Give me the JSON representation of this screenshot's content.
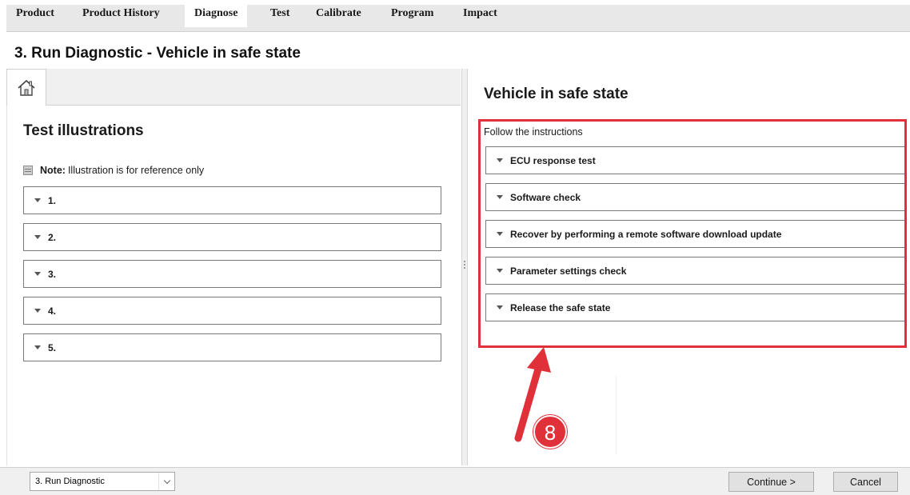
{
  "menu": {
    "items": [
      {
        "label": "Product"
      },
      {
        "label": "Product History"
      },
      {
        "label": "Diagnose",
        "active": true
      },
      {
        "label": "Test"
      },
      {
        "label": "Calibrate"
      },
      {
        "label": "Program"
      },
      {
        "label": "Impact"
      }
    ]
  },
  "page": {
    "title": "3. Run Diagnostic - Vehicle in safe state"
  },
  "left": {
    "home_icon": "home-icon",
    "heading": "Test illustrations",
    "note_label": "Note:",
    "note_text": "Illustration is for reference only",
    "items": [
      {
        "label": "1."
      },
      {
        "label": "2."
      },
      {
        "label": "3."
      },
      {
        "label": "4."
      },
      {
        "label": "5."
      }
    ]
  },
  "right": {
    "heading": "Vehicle in safe state",
    "instructions": "Follow the instructions",
    "sections": [
      {
        "label": "ECU response test"
      },
      {
        "label": "Software check"
      },
      {
        "label": "Recover by performing a remote software download update"
      },
      {
        "label": "Parameter settings check"
      },
      {
        "label": "Release the safe state"
      }
    ]
  },
  "annotation": {
    "badge": "8",
    "color": "#e0303a"
  },
  "footer": {
    "step_select": "3. Run Diagnostic",
    "continue_label": "Continue >",
    "cancel_label": "Cancel"
  }
}
